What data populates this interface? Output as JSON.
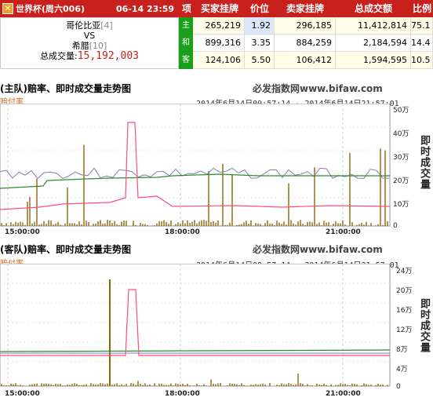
{
  "match": {
    "league": "世界杯(周六006)",
    "time": "06-14 23:59",
    "home_team": "哥伦比亚",
    "home_rank": "[4]",
    "vs": "VS",
    "away_team": "希腊",
    "away_rank": "[10]",
    "total_label": "总成交量:",
    "total_value": "15,192,003"
  },
  "table": {
    "headers": [
      "项",
      "买家挂牌",
      "价位",
      "卖家挂牌",
      "总成交额",
      "比例"
    ],
    "rows": [
      {
        "label": "主",
        "buy": "265,219",
        "price": "1.92",
        "sell": "296,185",
        "total": "11,412,814",
        "ratio": "75.1"
      },
      {
        "label": "和",
        "buy": "899,316",
        "price": "3.35",
        "sell": "884,259",
        "total": "2,184,594",
        "ratio": "14.4"
      },
      {
        "label": "客",
        "buy": "124,106",
        "price": "5.50",
        "sell": "106,412",
        "total": "1,594,595",
        "ratio": "10.5"
      }
    ]
  },
  "chart1": {
    "title": "(主队)赔率、即时成交量走势图",
    "site": "必发指数网www.bifaw.com",
    "legend": "赔付率",
    "range": "2014年6月14日09:57:14 - 2014年6月14日21:57:01",
    "yaxis_title": "即时成交量",
    "yticks": [
      "50万",
      "40万",
      "30万",
      "20万",
      "10万",
      "0"
    ],
    "xticks": [
      "15:00:00",
      "18:00:00",
      "21:00:00"
    ]
  },
  "chart2": {
    "title": "(客队)赔率、即时成交量走势图",
    "site": "必发指数网www.bifaw.com",
    "legend": "赔付率",
    "range": "2014年6月14日09:57:14 - 2014年6月14日21:57:01",
    "yaxis_title": "即时成交量",
    "yticks": [
      "24万",
      "20万",
      "16万",
      "12万",
      "8万",
      "4万",
      "0"
    ],
    "xticks": [
      "15:00:00",
      "18:00:00",
      "21:00:00"
    ]
  },
  "colors": {
    "header_red": "#c8201c",
    "label_green": "#1a9f1a",
    "volume": "#8b6508",
    "line_pink": "#ff4d7a",
    "line_green": "#2e8b2e",
    "line_purple": "#8080b0"
  }
}
